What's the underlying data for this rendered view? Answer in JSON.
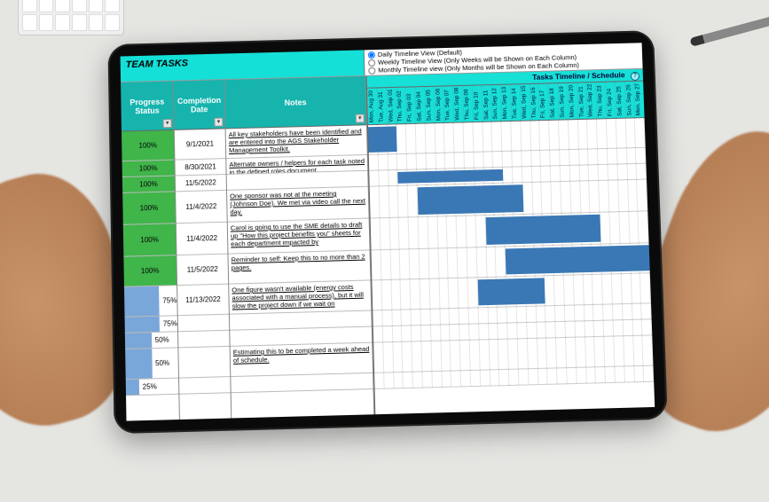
{
  "title": "TEAM TASKS",
  "views": {
    "daily": {
      "label": "Daily Timeline View (Default)",
      "selected": true
    },
    "weekly": {
      "label": "Weekly Timeline View (Only Weeks will be Shown on Each Column)",
      "selected": false
    },
    "monthly": {
      "label": "Monthly Timeline view (Only Months will be Shown on Each Column)",
      "selected": false
    }
  },
  "headers": {
    "progress": "Progress Status",
    "date": "Completion Date",
    "notes": "Notes",
    "timeline": "Tasks Timeline / Schedule"
  },
  "timeline_dates": [
    "Mon, Aug 30",
    "Tue, Aug 31",
    "Wed, Sep 01",
    "Thu, Sep 02",
    "Fri, Sep 03",
    "Sat, Sep 04",
    "Sun, Sep 05",
    "Mon, Sep 06",
    "Tue, Sep 07",
    "Wed, Sep 08",
    "Thu, Sep 09",
    "Fri, Sep 10",
    "Sat, Sep 11",
    "Sun, Sep 12",
    "Mon, Sep 13",
    "Tue, Sep 14",
    "Wed, Sep 15",
    "Thu, Sep 16",
    "Fri, Sep 17",
    "Sat, Sep 18",
    "Sun, Sep 19",
    "Mon, Sep 20",
    "Tue, Sep 21",
    "Wed, Sep 22",
    "Thu, Sep 23",
    "Fri, Sep 24",
    "Sat, Sep 25",
    "Sun, Sep 26",
    "Mon, Sep 27"
  ],
  "rows": [
    {
      "size": "md",
      "progress_pct": 100,
      "progress_label": "100%",
      "date": "9/1/2021",
      "notes": "All key stakeholders have been identified and are entered into the AGS Stakeholder Management Toolkit.",
      "bar_start": 0,
      "bar_span": 3
    },
    {
      "size": "sm",
      "progress_pct": 100,
      "progress_label": "100%",
      "date": "8/30/2021",
      "notes": "Alternate owners / helpers for each task noted in the defined roles document.",
      "bar_start": null,
      "bar_span": null
    },
    {
      "size": "sm",
      "progress_pct": 100,
      "progress_label": "100%",
      "date": "11/5/2022",
      "notes": "",
      "bar_start": 3,
      "bar_span": 11
    },
    {
      "size": "lg",
      "progress_pct": 100,
      "progress_label": "100%",
      "date": "11/4/2022",
      "notes": "One sponsor was not at the meeting (Johnson Doe). We met via video call the next day.",
      "bar_start": 5,
      "bar_span": 11
    },
    {
      "size": "lg",
      "progress_pct": 100,
      "progress_label": "100%",
      "date": "11/4/2022",
      "notes": "Carol is going to use the SME details to draft up \"How this project benefits you\" sheets for each department impacted by",
      "bar_start": 12,
      "bar_span": 12
    },
    {
      "size": "md",
      "progress_pct": 100,
      "progress_label": "100%",
      "date": "11/5/2022",
      "notes": "Reminder to self: Keep this to no more than 2 pages.",
      "bar_start": 14,
      "bar_span": 15
    },
    {
      "size": "md",
      "progress_pct": 75,
      "progress_label": "75%",
      "date": "11/13/2022",
      "notes": "One figure wasn't available (energy costs associated with a manual process), but it will slow the project down if we wait on",
      "bar_start": 11,
      "bar_span": 7
    },
    {
      "size": "sm",
      "progress_pct": 75,
      "progress_label": "75%",
      "date": "",
      "notes": "",
      "bar_start": null,
      "bar_span": null
    },
    {
      "size": "sm",
      "progress_pct": 50,
      "progress_label": "50%",
      "date": "",
      "notes": "",
      "bar_start": null,
      "bar_span": null
    },
    {
      "size": "md",
      "progress_pct": 50,
      "progress_label": "50%",
      "date": "",
      "notes": "Estimating this to be completed a week ahead of schedule.",
      "bar_start": null,
      "bar_span": null
    },
    {
      "size": "sm",
      "progress_pct": 25,
      "progress_label": "25%",
      "date": "",
      "notes": "",
      "bar_start": null,
      "bar_span": null
    }
  ],
  "colors": {
    "primary": "#14e0d8",
    "header": "#16b4ad",
    "barfull": "#3fb54a",
    "barpartial": "#7aa7d9",
    "gantt": "#3a78b5"
  }
}
